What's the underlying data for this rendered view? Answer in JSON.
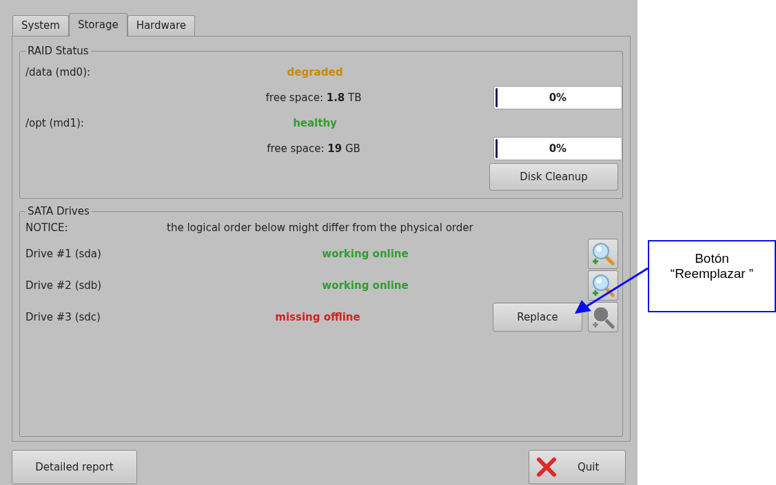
{
  "tabs": [
    {
      "label": "System",
      "selected": false
    },
    {
      "label": "Storage",
      "selected": true
    },
    {
      "label": "Hardware",
      "selected": false
    }
  ],
  "raid": {
    "title": "RAID Status",
    "arrays": [
      {
        "label": "/data (md0):",
        "status": "degraded",
        "color": "#c98a00",
        "free_space": "free space: **1.8** TB",
        "level": 0,
        "reading": "0%"
      },
      {
        "label": "/opt (md1):",
        "status": "healthy",
        "color": "#2e9e2e",
        "free_space": "free space: **19** GB",
        "level": 0,
        "reading": "0%"
      }
    ],
    "cleanup_button": "Disk Cleanup"
  },
  "sata": {
    "title": "SATA Drives",
    "notice_label": "NOTICE:",
    "notice": "the logical order below might differ from the physical order",
    "drives": [
      {
        "label": "Drive #1 (sda)",
        "status": "working online",
        "color": "#2e9e2e",
        "inspect_enabled": true
      },
      {
        "label": "Drive #2 (sdb)",
        "status": "working online",
        "color": "#2e9e2e",
        "inspect_enabled": true
      },
      {
        "label": "Drive #3 (sdc)",
        "status": "missing offline",
        "color": "#d42020",
        "inspect_enabled": false,
        "replace_button": "Replace"
      }
    ]
  },
  "buttons": {
    "report": "Detailed report",
    "quit": "Quit"
  },
  "callout": {
    "text": "Botón “Reemplazar ”"
  }
}
